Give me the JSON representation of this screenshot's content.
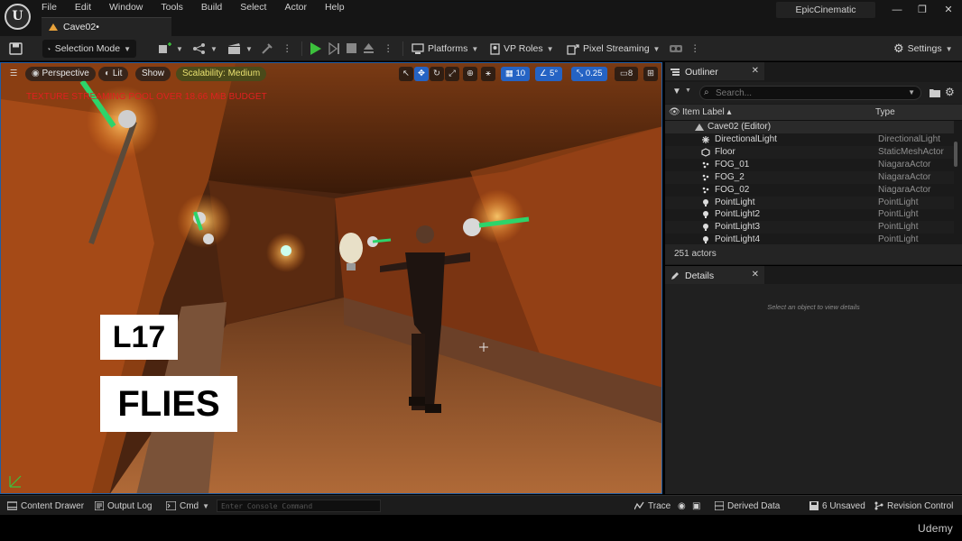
{
  "app": {
    "logo_text": "U",
    "menu": [
      "File",
      "Edit",
      "Window",
      "Tools",
      "Build",
      "Select",
      "Actor",
      "Help"
    ],
    "document_tab": "Cave02•",
    "project_name": "EpicCinematic",
    "window_controls": [
      "—",
      "❐",
      "✕"
    ]
  },
  "toolbar": {
    "selection_mode": "Selection Mode",
    "platforms": "Platforms",
    "vp_roles": "VP Roles",
    "pixel_streaming": "Pixel Streaming",
    "settings": "Settings"
  },
  "viewport": {
    "perspective": "Perspective",
    "lit": "Lit",
    "show": "Show",
    "scalability": "Scalability: Medium",
    "grid_snap": "10",
    "rotation_snap": "5°",
    "scale_snap": "0.25",
    "camera_speed": "8",
    "warning": "TEXTURE STREAMING POOL OVER 18.66 MiB BUDGET",
    "overlay_lesson": "L17",
    "overlay_title": "FLIES"
  },
  "outliner": {
    "tab_title": "Outliner",
    "search_placeholder": "Search...",
    "col_label": "Item Label ▴",
    "col_type": "Type",
    "root": "Cave02 (Editor)",
    "rows": [
      {
        "name": "DirectionalLight",
        "type": "DirectionalLight",
        "icon": "directional-light-icon"
      },
      {
        "name": "Floor",
        "type": "StaticMeshActor",
        "icon": "static-mesh-icon"
      },
      {
        "name": "FOG_01",
        "type": "NiagaraActor",
        "icon": "niagara-icon"
      },
      {
        "name": "FOG_2",
        "type": "NiagaraActor",
        "icon": "niagara-icon"
      },
      {
        "name": "FOG_02",
        "type": "NiagaraActor",
        "icon": "niagara-icon"
      },
      {
        "name": "PointLight",
        "type": "PointLight",
        "icon": "point-light-icon"
      },
      {
        "name": "PointLight2",
        "type": "PointLight",
        "icon": "point-light-icon"
      },
      {
        "name": "PointLight3",
        "type": "PointLight",
        "icon": "point-light-icon"
      },
      {
        "name": "PointLight4",
        "type": "PointLight",
        "icon": "point-light-icon"
      }
    ],
    "actor_count": "251 actors"
  },
  "details": {
    "tab_title": "Details",
    "empty_text": "Select an object to view details"
  },
  "statusbar": {
    "content_drawer": "Content Drawer",
    "output_log": "Output Log",
    "cmd": "Cmd",
    "console_placeholder": "Enter Console Command",
    "trace": "Trace",
    "derived_data": "Derived Data",
    "unsaved": "6 Unsaved",
    "revision_control": "Revision Control"
  },
  "watermark": "Udemy",
  "colors": {
    "accent_blue": "#2563c4",
    "play_green": "#3cc13c",
    "warning_red": "#e02020",
    "scalability_bg": "#4a4a1a"
  }
}
